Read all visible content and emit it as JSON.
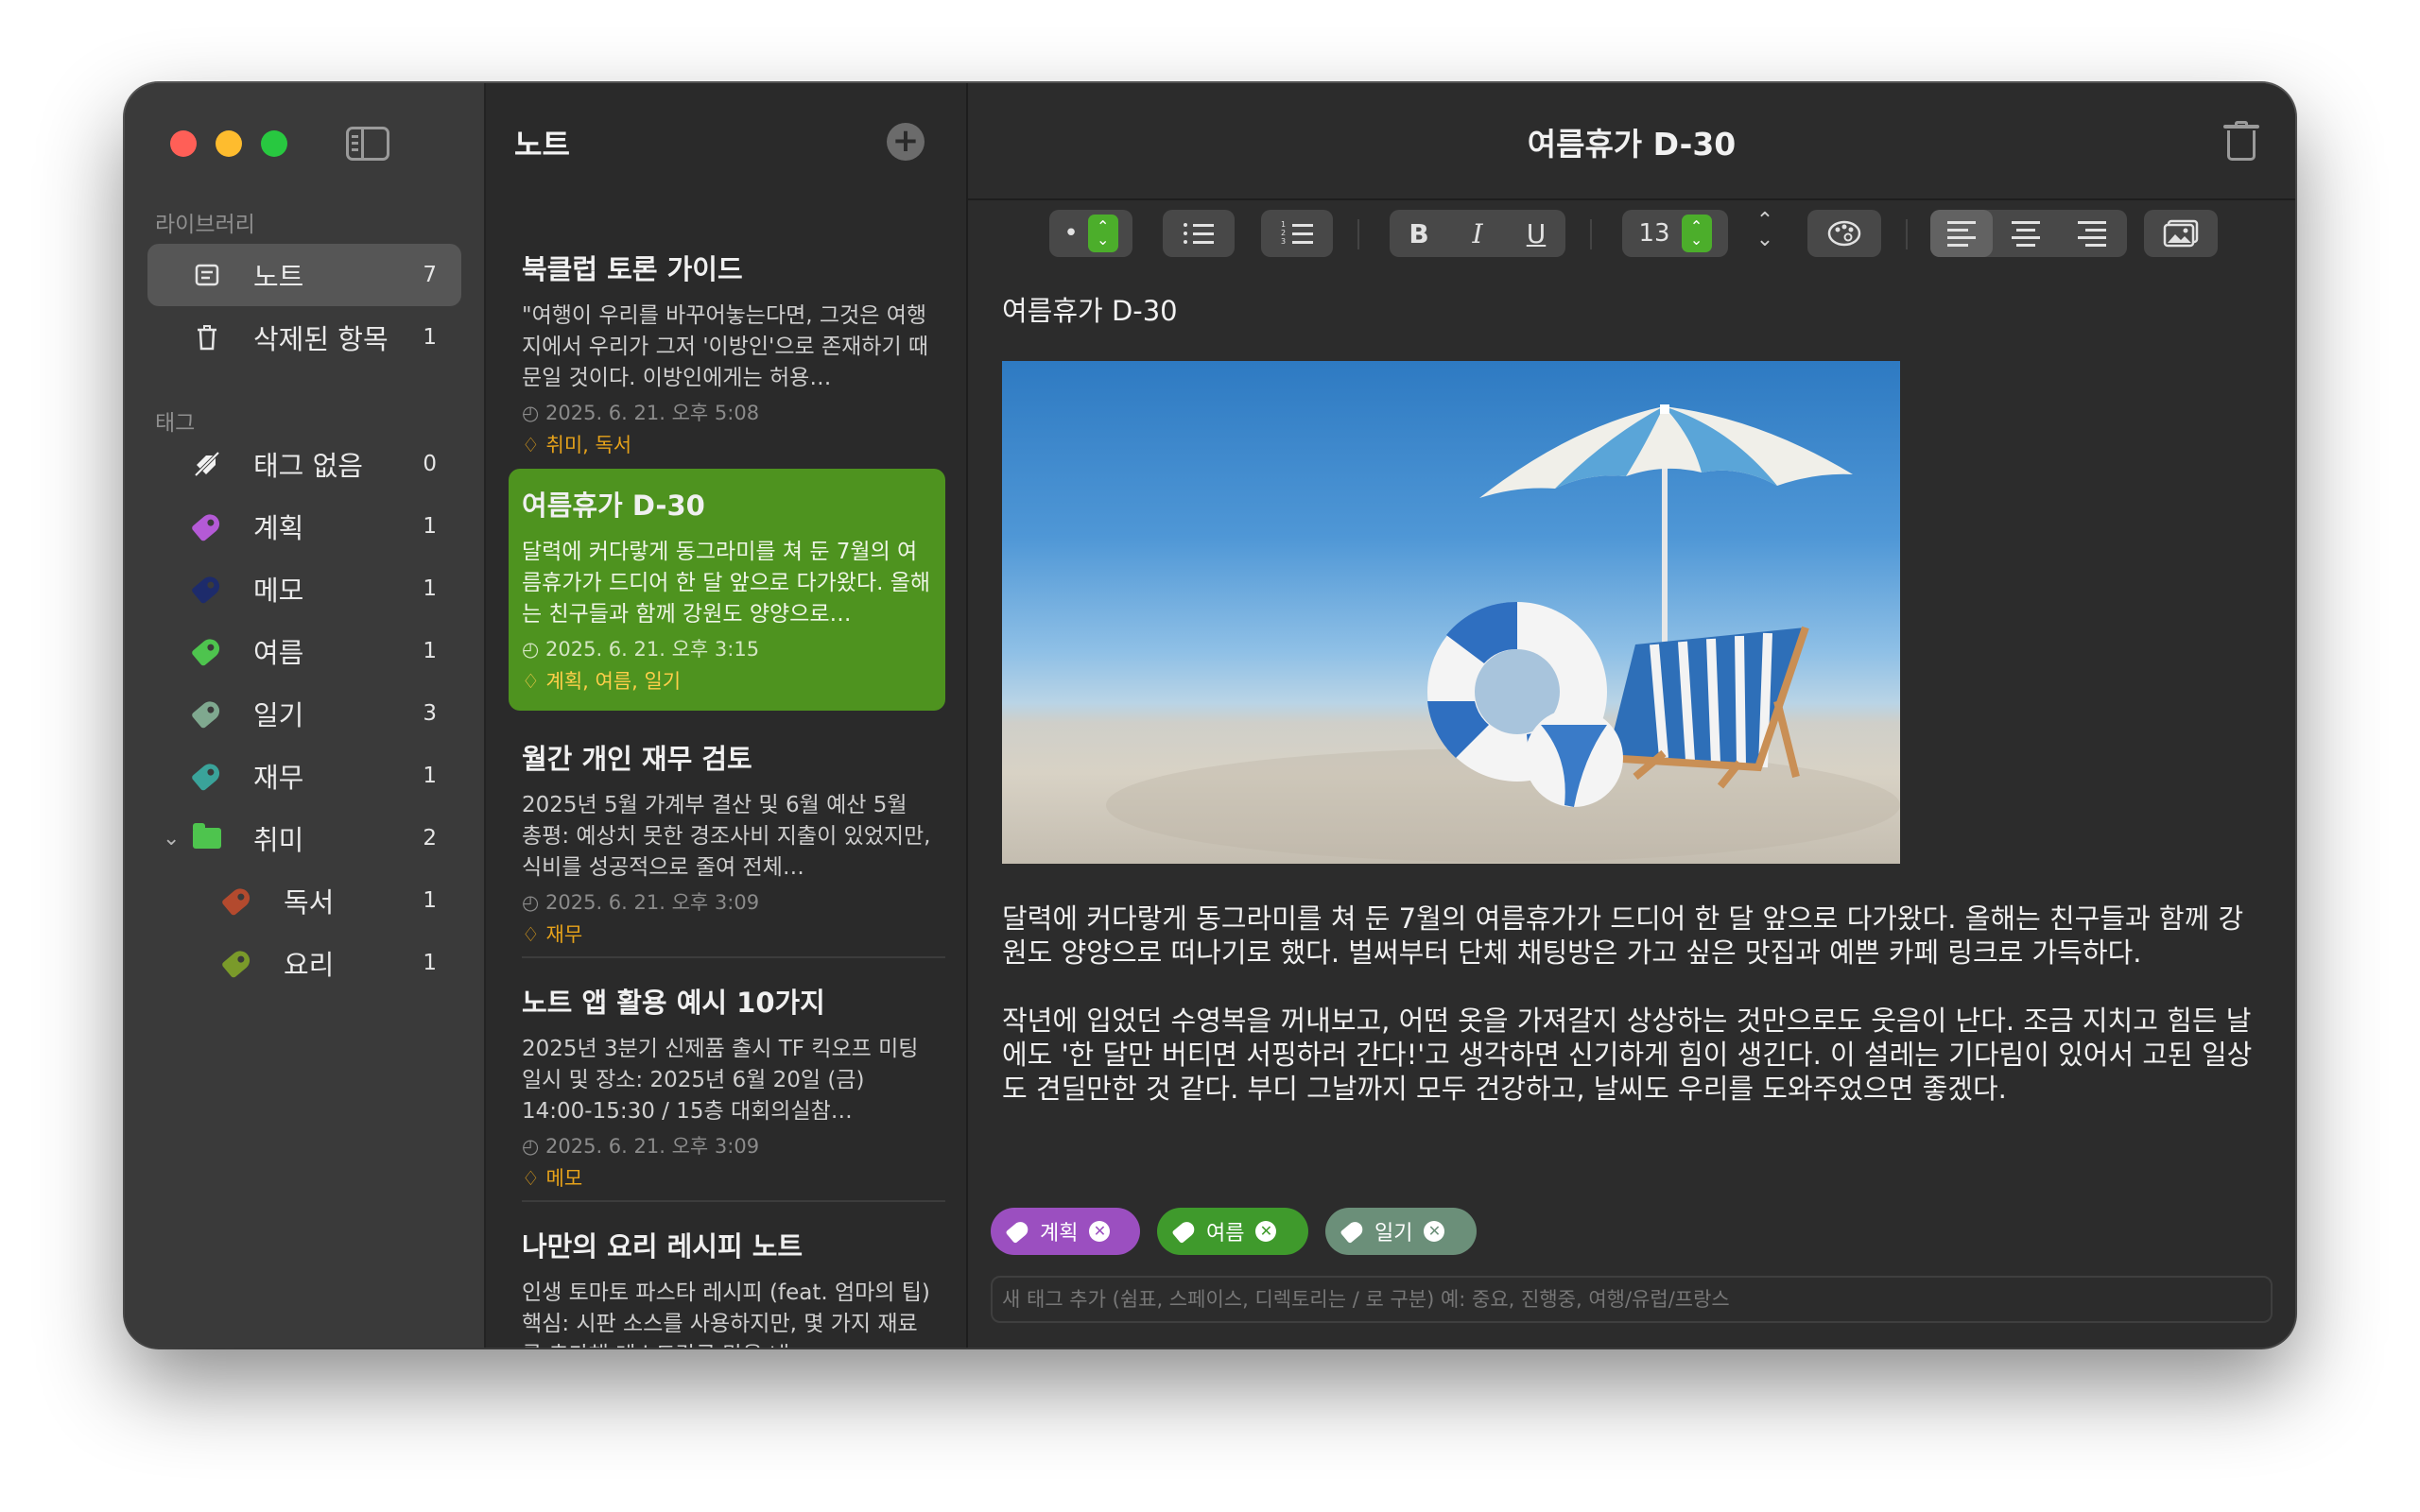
{
  "sidebar": {
    "library_label": "라이브러리",
    "library": [
      {
        "label": "노트",
        "count": "7"
      },
      {
        "label": "삭제된 항목",
        "count": "1"
      }
    ],
    "tags_label": "태그",
    "tags": [
      {
        "label": "태그 없음",
        "count": "0",
        "color": "#ffffff"
      },
      {
        "label": "계획",
        "count": "1",
        "color": "#b45ad6"
      },
      {
        "label": "메모",
        "count": "1",
        "color": "#1d2b6b"
      },
      {
        "label": "여름",
        "count": "1",
        "color": "#4ec44e"
      },
      {
        "label": "일기",
        "count": "3",
        "color": "#7fa88f"
      },
      {
        "label": "재무",
        "count": "1",
        "color": "#3aa39a"
      },
      {
        "label": "취미",
        "count": "2",
        "color": "#4ec44e"
      },
      {
        "label": "독서",
        "count": "1",
        "color": "#b34a2e"
      },
      {
        "label": "요리",
        "count": "1",
        "color": "#7a9a2a"
      }
    ]
  },
  "notelist": {
    "title": "노트",
    "notes": [
      {
        "title": "북클럽 토론 가이드",
        "preview": "\"여행이 우리를 바꾸어놓는다면, 그것은 여행지에서 우리가 그저 '이방인'으로 존재하기 때문일 것이다. 이방인에게는 허용…",
        "date": "◴ 2025. 6. 21. 오후 5:08",
        "tags": "♢ 취미, 독서"
      },
      {
        "title": "여름휴가 D-30",
        "preview": "달력에 커다랗게 동그라미를 쳐 둔 7월의 여름휴가가 드디어 한 달 앞으로 다가왔다. 올해는 친구들과 함께 강원도 양양으로…",
        "date": "◴ 2025. 6. 21. 오후 3:15",
        "tags": "♢ 계획, 여름, 일기"
      },
      {
        "title": "월간 개인 재무 검토",
        "preview": "2025년 5월 가계부 결산 및 6월 예산 5월 총평: 예상치 못한 경조사비 지출이 있었지만, 식비를 성공적으로 줄여 전체…",
        "date": "◴ 2025. 6. 21. 오후 3:09",
        "tags": "♢ 재무"
      },
      {
        "title": "노트 앱 활용 예시 10가지",
        "preview": "2025년 3분기 신제품 출시 TF 킥오프 미팅일시 및 장소: 2025년 6월 20일 (금) 14:00-15:30 / 15층 대회의실참…",
        "date": "◴ 2025. 6. 21. 오후 3:09",
        "tags": "♢ 메모"
      },
      {
        "title": "나만의 요리 레시피 노트",
        "preview": "인생 토마토 파스타 레시피 (feat. 엄마의 팁)핵심: 시판 소스를 사용하지만, 몇 가지 재료를 추가해 레스토랑급 맛을 내…",
        "date": "",
        "tags": ""
      }
    ]
  },
  "editor": {
    "window_title": "여름휴가 D-30",
    "toolbar": {
      "bullet_style": "•",
      "font_size": "13",
      "bold": "B",
      "italic": "I",
      "underline": "U"
    },
    "doc_title": "여름휴가 D-30",
    "paragraphs": [
      "달력에 커다랗게 동그라미를 쳐 둔 7월의 여름휴가가 드디어 한 달 앞으로 다가왔다. 올해는 친구들과 함께 강원도 양양으로 떠나기로 했다. 벌써부터 단체 채팅방은 가고 싶은 맛집과 예쁜 카페 링크로 가득하다.",
      "작년에 입었던 수영복을 꺼내보고, 어떤 옷을 가져갈지 상상하는 것만으로도 웃음이 난다. 조금 지치고 힘든 날에도 '한 달만 버티면 서핑하러 간다!'고 생각하면 신기하게 힘이 생긴다. 이 설레는 기다림이 있어서 고된 일상도 견딜만한 것 같다. 부디 그날까지 모두 건강하고, 날씨도 우리를 도와주었으면 좋겠다."
    ],
    "tag_chips": [
      {
        "label": "계획",
        "color": "#9b4fc0"
      },
      {
        "label": "여름",
        "color": "#3f9a2c"
      },
      {
        "label": "일기",
        "color": "#6b8f79"
      }
    ],
    "tag_input_placeholder": "새 태그 추가 (쉼표, 스페이스, 디렉토리는 / 로 구분) 예: 중요, 진행중, 여행/유럽/프랑스"
  },
  "colors": {
    "accent_selected": "#4e931f",
    "tag_text": "#e6a21a"
  }
}
